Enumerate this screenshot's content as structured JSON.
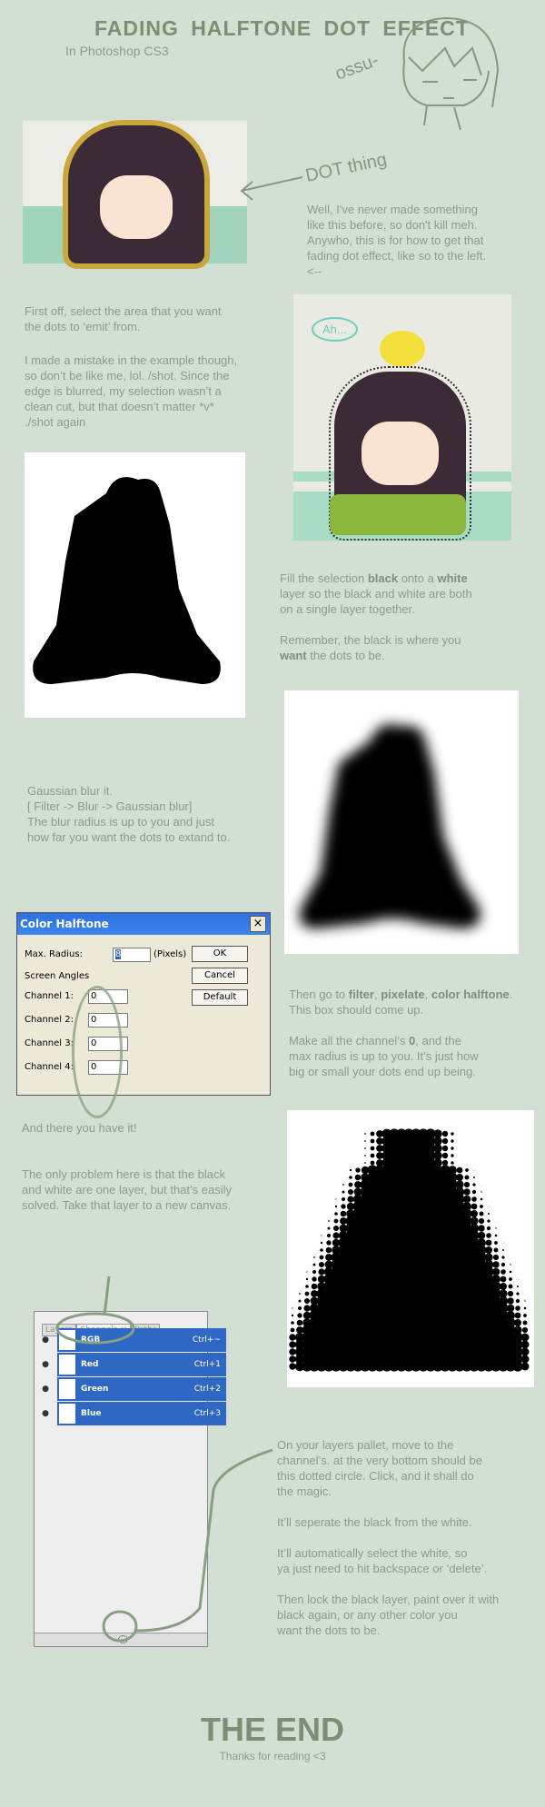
{
  "header": {
    "title": "FADING HALFTONE DOT EFFECT",
    "subtitle": "In Photoshop CS3",
    "sketch_text": "ossu-"
  },
  "intro": {
    "annotation": "DOT thing",
    "text": "Well, I've never made something\nlike this before, so don't kill meh.\nAnywho, this is for how to get that\nfading dot effect, like so to the left.\n<--"
  },
  "step1": {
    "p1": "First off, select the area that you want\nthe dots to ‘emit’ from.",
    "p2": "I made a mistake in the example though,\nso don’t be like me, lol. /shot. Since the\nedge is blurred, my selection wasn’t a\nclean cut, but that doesn’t matter *v*\n ./shot again",
    "bubble": "Ah..."
  },
  "step2": {
    "a": "Fill the selection ",
    "b1": "black",
    "c": " onto a ",
    "b2": "white",
    "d": "\nlayer so the black and white are both\non a single layer together.",
    "e": "Remember, the black is where you\n",
    "b3": "want",
    "f": " the dots to be."
  },
  "step3": {
    "text": "Gaussian blur it.\n[ Filter -> Blur -> Gaussian blur]\nThe blur radius is up to you and just\nhow far you want the dots to extand to."
  },
  "dialog": {
    "title": "Color Halftone",
    "max_radius_label": "Max. Radius:",
    "max_radius_value": "8",
    "unit": "(Pixels)",
    "screen_angles": "Screen Angles",
    "channels": [
      {
        "label": "Channel 1:",
        "value": "0"
      },
      {
        "label": "Channel 2:",
        "value": "0"
      },
      {
        "label": "Channel 3:",
        "value": "0"
      },
      {
        "label": "Channel 4:",
        "value": "0"
      }
    ],
    "ok": "OK",
    "cancel": "Cancel",
    "default": "Default",
    "close": "×"
  },
  "step4": {
    "a": "Then go to ",
    "b1": "filter",
    "c": ", ",
    "b2": "pixelate",
    "d": ", ",
    "b3": "color halftone",
    "e": ".\nThis box should come up.",
    "f": "Make all the channel’s ",
    "b4": "0",
    "g": ", and the\nmax radius is up to you. It’s just how\nbig or small your dots end up being."
  },
  "step5": {
    "p1": "And there you have it!",
    "p2": "The only problem here is that the black\nand white are one layer, but that’s easily\nsolved. Take that layer to a new canvas."
  },
  "panel": {
    "tabs": [
      "Layers",
      "Channels ×",
      "Paths"
    ],
    "rows": [
      {
        "name": "RGB",
        "shortcut": "Ctrl+~"
      },
      {
        "name": "Red",
        "shortcut": "Ctrl+1"
      },
      {
        "name": "Green",
        "shortcut": "Ctrl+2"
      },
      {
        "name": "Blue",
        "shortcut": "Ctrl+3"
      }
    ]
  },
  "step6": {
    "text": "On your layers pallet, move to the\nchannel’s. at the very bottom should be\nthis dotted circle. Click, and it shall do\nthe magic.\n\nIt’ll seperate the black from the white.\n\nIt’ll automatically select the white, so\nya just need to hit backspace or ‘delete’.\n\nThen lock the black layer, paint over it with\nblack again, or any other color you\nwant the dots to be."
  },
  "footer": {
    "end": "THE END",
    "thanks": "Thanks for reading <3"
  },
  "colors": {
    "background": "#d3dfd2",
    "text": "#8d9b89",
    "title": "#7d8e75",
    "selection_blue": "#2f67c4"
  }
}
